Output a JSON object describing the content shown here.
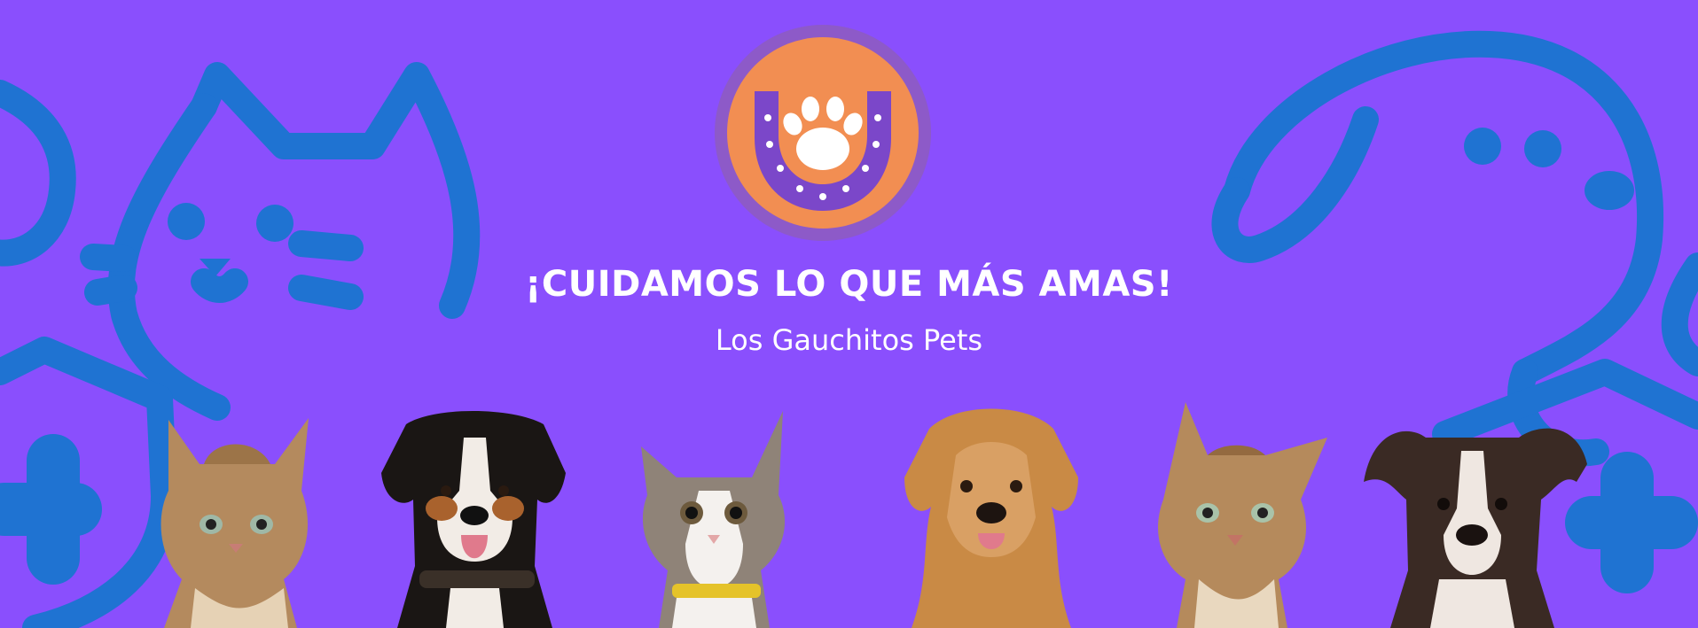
{
  "banner": {
    "headline": "¡CUIDAMOS LO QUE MÁS AMAS!",
    "subtitle": "Los Gauchitos Pets",
    "logo_icon": "paw-horseshoe-icon",
    "colors": {
      "background": "#8a4ffd",
      "line_art": "#1f73d2",
      "logo_orange": "#f28e52",
      "logo_ring": "#8d5ac8",
      "text": "#ffffff"
    },
    "pets": [
      {
        "name": "tabby-cat-looking-up",
        "kind": "cat"
      },
      {
        "name": "bernese-dog",
        "kind": "dog"
      },
      {
        "name": "white-tabby-kitten",
        "kind": "cat"
      },
      {
        "name": "golden-retriever",
        "kind": "dog"
      },
      {
        "name": "bengal-cat",
        "kind": "cat"
      },
      {
        "name": "brindle-puppy",
        "kind": "dog"
      }
    ]
  }
}
